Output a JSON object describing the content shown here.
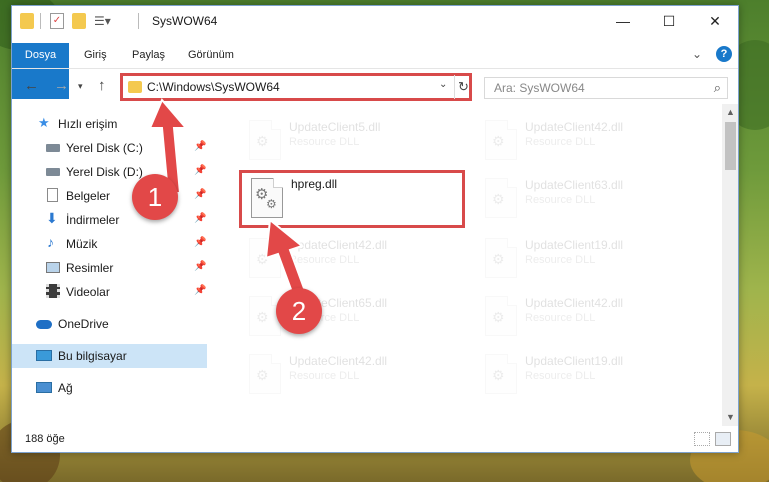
{
  "window": {
    "title": "SysWOW64"
  },
  "ribbon": {
    "tabs": [
      "Dosya",
      "Giriş",
      "Paylaş",
      "Görünüm"
    ]
  },
  "address": {
    "path": "C:\\Windows\\SysWOW64"
  },
  "search": {
    "placeholder": "Ara: SysWOW64"
  },
  "navpane": {
    "items": [
      {
        "label": "Hızlı erişim",
        "icon": "star-icon"
      },
      {
        "label": "Yerel Disk (C:)",
        "icon": "drive-icon"
      },
      {
        "label": "Yerel Disk (D:)",
        "icon": "drive-icon"
      },
      {
        "label": "Belgeler",
        "icon": "document-icon"
      },
      {
        "label": "İndirmeler",
        "icon": "download-icon"
      },
      {
        "label": "Müzik",
        "icon": "music-icon"
      },
      {
        "label": "Resimler",
        "icon": "pictures-icon"
      },
      {
        "label": "Videolar",
        "icon": "video-icon"
      },
      {
        "label": "OneDrive",
        "icon": "cloud-icon"
      },
      {
        "label": "Bu bilgisayar",
        "icon": "computer-icon"
      },
      {
        "label": "Ağ",
        "icon": "network-icon"
      }
    ]
  },
  "files": {
    "col1": [
      {
        "name": "UpdateClient5.dll",
        "type": "Resource DLL"
      },
      {
        "name": "hpreg.dll",
        "type": ""
      },
      {
        "name": "UpdateClient42.dll",
        "type": "Resource DLL"
      },
      {
        "name": "UpdateClient65.dll",
        "type": "Resource DLL"
      },
      {
        "name": "UpdateClient42.dll",
        "type": "Resource DLL"
      }
    ],
    "col2": [
      {
        "name": "UpdateClient42.dll",
        "type": "Resource DLL"
      },
      {
        "name": "UpdateClient63.dll",
        "type": "Resource DLL"
      },
      {
        "name": "UpdateClient19.dll",
        "type": "Resource DLL"
      },
      {
        "name": "UpdateClient42.dll",
        "type": "Resource DLL"
      },
      {
        "name": "UpdateClient19.dll",
        "type": "Resource DLL"
      }
    ]
  },
  "status": {
    "count": "188 öğe"
  },
  "callouts": {
    "one": "1",
    "two": "2"
  },
  "colors": {
    "accent": "#1979ca",
    "highlight": "#d84a4a",
    "selection": "#cce4f7"
  }
}
